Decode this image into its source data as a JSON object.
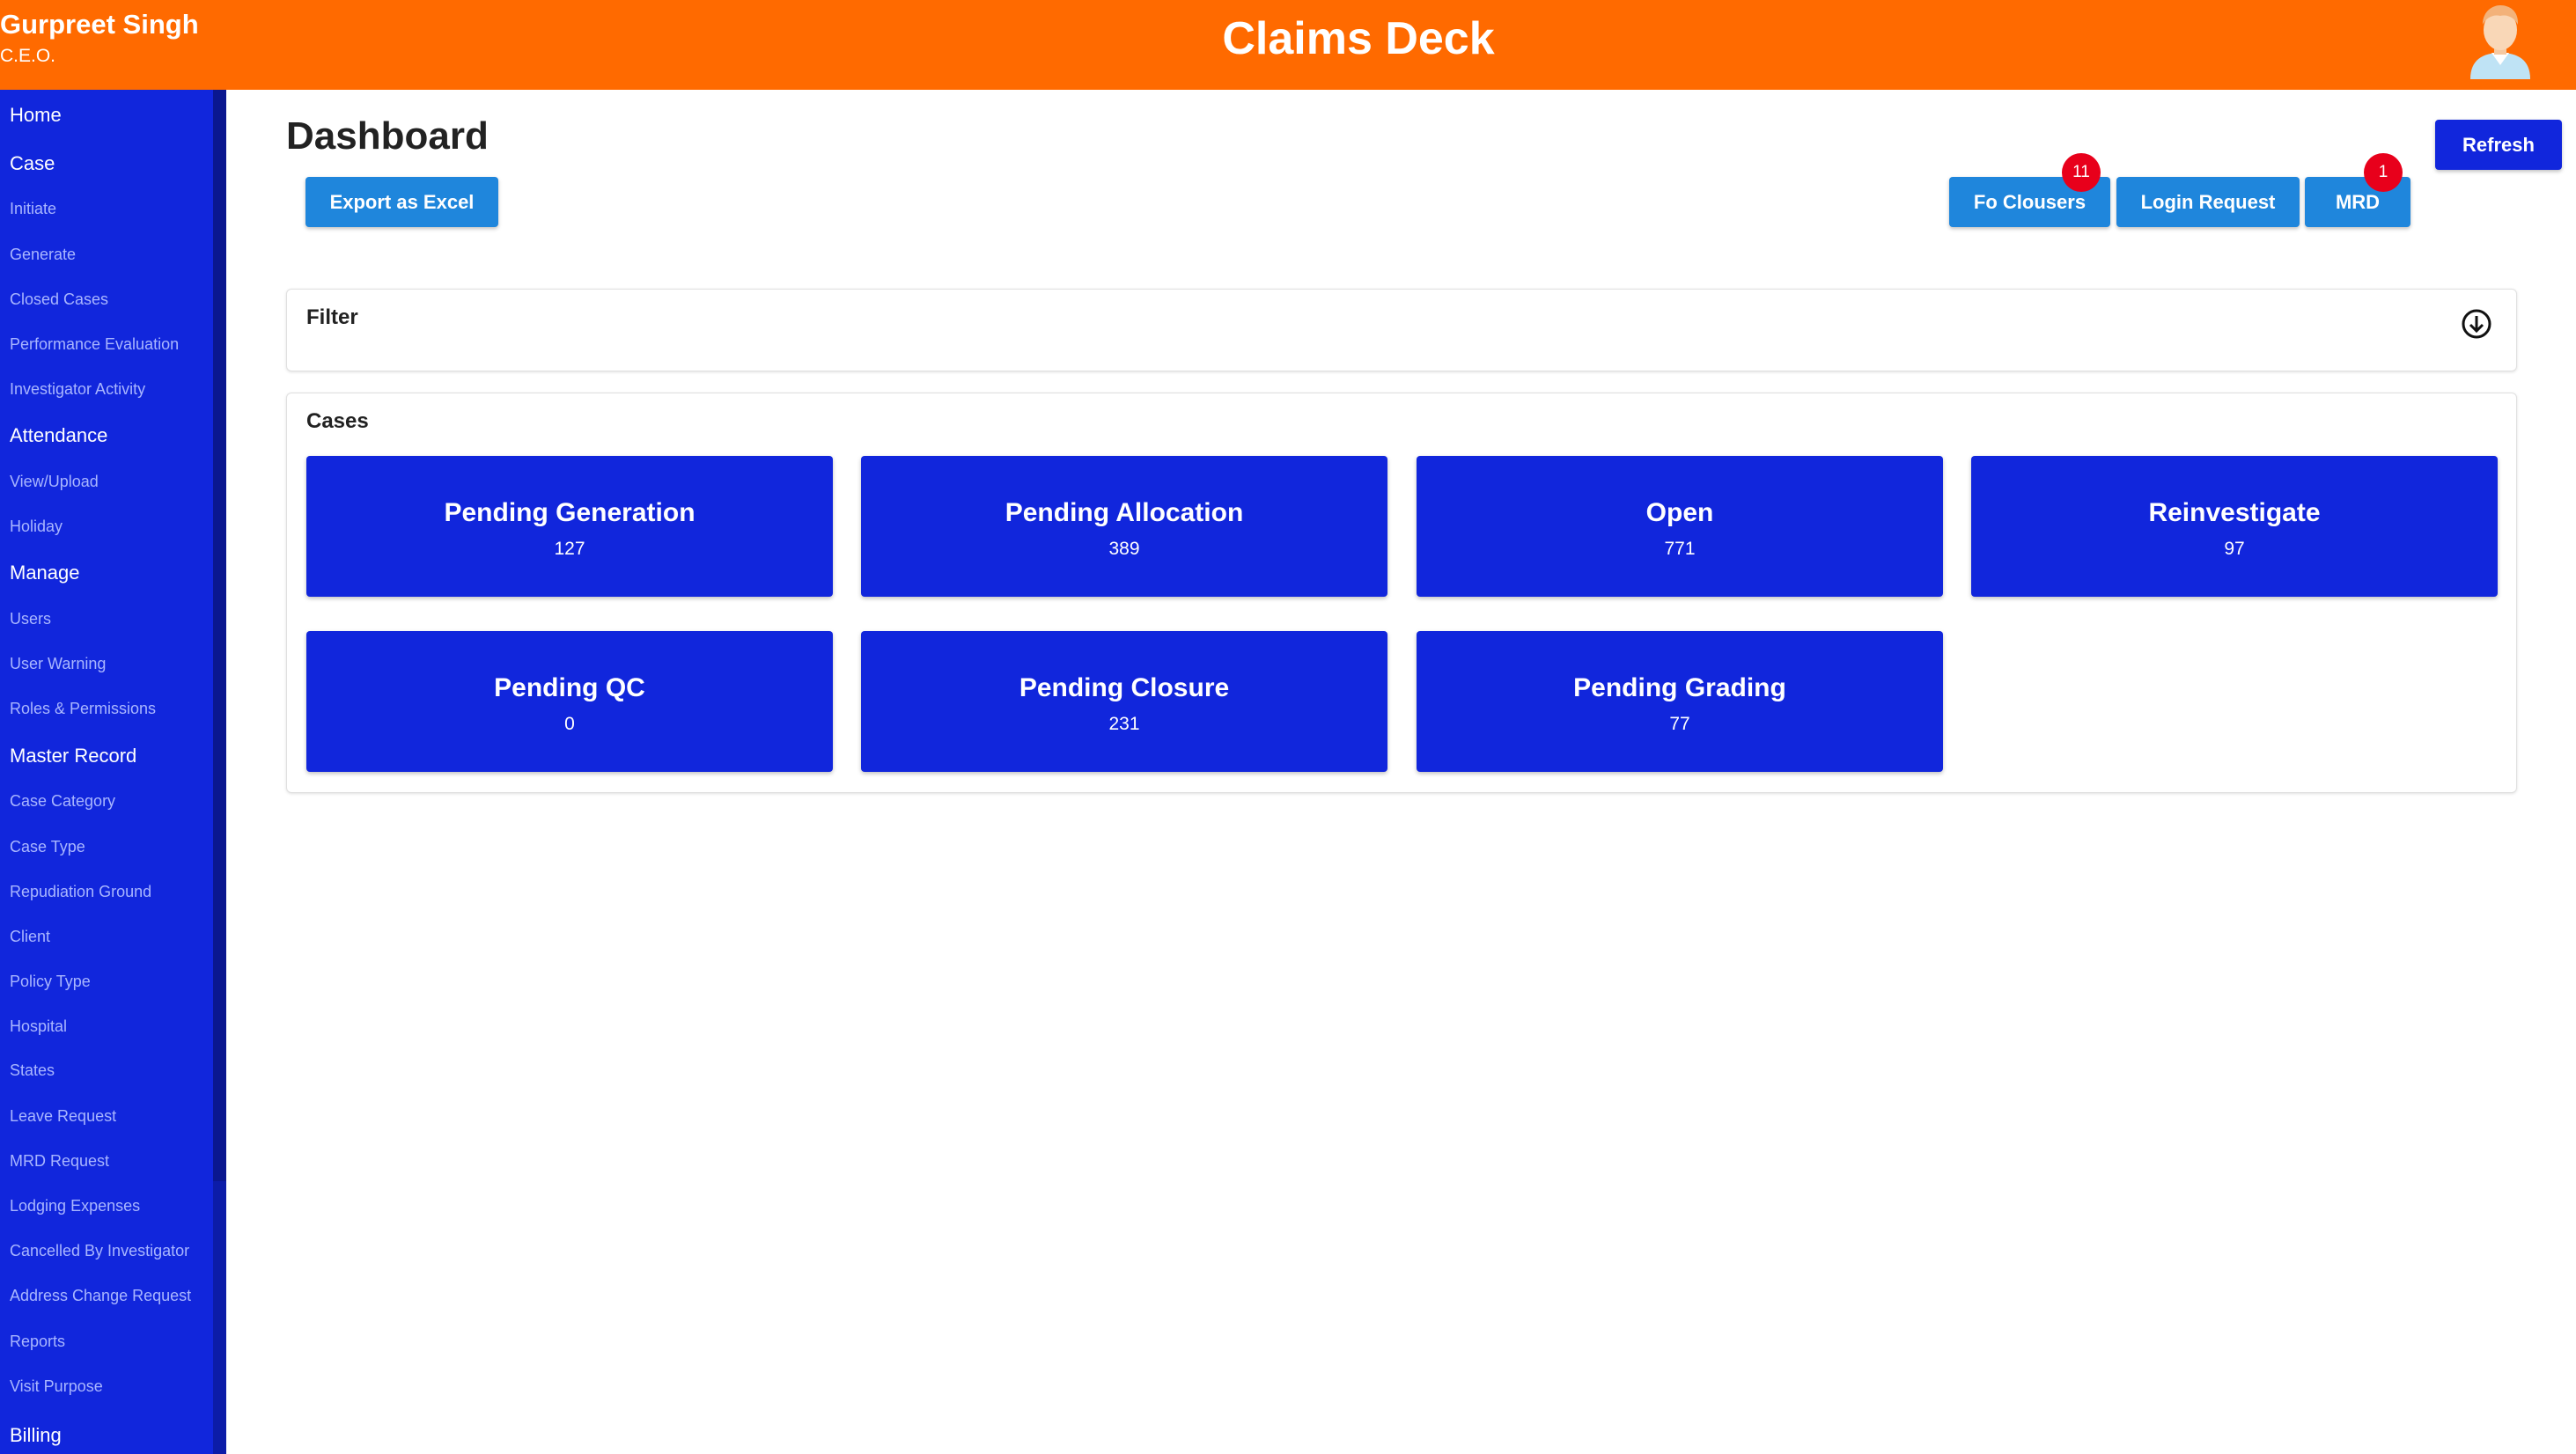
{
  "header": {
    "user_name": "Gurpreet Singh",
    "user_role": "C.E.O.",
    "app_title": "Claims Deck",
    "avatar_icon": "user-avatar-icon"
  },
  "sidebar": {
    "items": [
      {
        "label": "Home",
        "type": "section"
      },
      {
        "label": "Case",
        "type": "section"
      },
      {
        "label": "Initiate",
        "type": "sub"
      },
      {
        "label": "Generate",
        "type": "sub"
      },
      {
        "label": "Closed Cases",
        "type": "sub"
      },
      {
        "label": "Performance Evaluation",
        "type": "sub"
      },
      {
        "label": "Investigator Activity",
        "type": "sub"
      },
      {
        "label": "Attendance",
        "type": "section"
      },
      {
        "label": "View/Upload",
        "type": "sub"
      },
      {
        "label": "Holiday",
        "type": "sub"
      },
      {
        "label": "Manage",
        "type": "section"
      },
      {
        "label": "Users",
        "type": "sub"
      },
      {
        "label": "User Warning",
        "type": "sub"
      },
      {
        "label": "Roles & Permissions",
        "type": "sub"
      },
      {
        "label": "Master Record",
        "type": "section"
      },
      {
        "label": "Case Category",
        "type": "sub"
      },
      {
        "label": "Case Type",
        "type": "sub"
      },
      {
        "label": "Repudiation Ground",
        "type": "sub"
      },
      {
        "label": "Client",
        "type": "sub"
      },
      {
        "label": "Policy Type",
        "type": "sub"
      },
      {
        "label": "Hospital",
        "type": "sub"
      },
      {
        "label": "States",
        "type": "sub"
      },
      {
        "label": "Leave Request",
        "type": "sub"
      },
      {
        "label": "MRD Request",
        "type": "sub"
      },
      {
        "label": "Lodging Expenses",
        "type": "sub"
      },
      {
        "label": "Cancelled By Investigator",
        "type": "sub"
      },
      {
        "label": "Address Change Request",
        "type": "sub"
      },
      {
        "label": "Reports",
        "type": "sub"
      },
      {
        "label": "Visit Purpose",
        "type": "sub"
      },
      {
        "label": "Billing",
        "type": "section"
      }
    ]
  },
  "main": {
    "title": "Dashboard",
    "export_label": "Export as Excel",
    "refresh_label": "Refresh",
    "actions": [
      {
        "label": "Fo Clousers",
        "badge": "11"
      },
      {
        "label": "Login Request",
        "badge": ""
      },
      {
        "label": "MRD",
        "badge": "1"
      }
    ],
    "filter": {
      "title": "Filter",
      "toggle_icon": "arrow-down-circle-icon"
    },
    "cases": {
      "title": "Cases",
      "cards": [
        {
          "label": "Pending Generation",
          "count": "127"
        },
        {
          "label": "Pending Allocation",
          "count": "389"
        },
        {
          "label": "Open",
          "count": "771"
        },
        {
          "label": "Reinvestigate",
          "count": "97"
        },
        {
          "label": "Pending QC",
          "count": "0"
        },
        {
          "label": "Pending Closure",
          "count": "231"
        },
        {
          "label": "Pending Grading",
          "count": "77"
        }
      ]
    }
  },
  "colors": {
    "header": "#ff6a00",
    "sidebar": "#1126dc",
    "card": "#1126dc",
    "button_light": "#1f86dc",
    "badge": "#e8001b"
  }
}
